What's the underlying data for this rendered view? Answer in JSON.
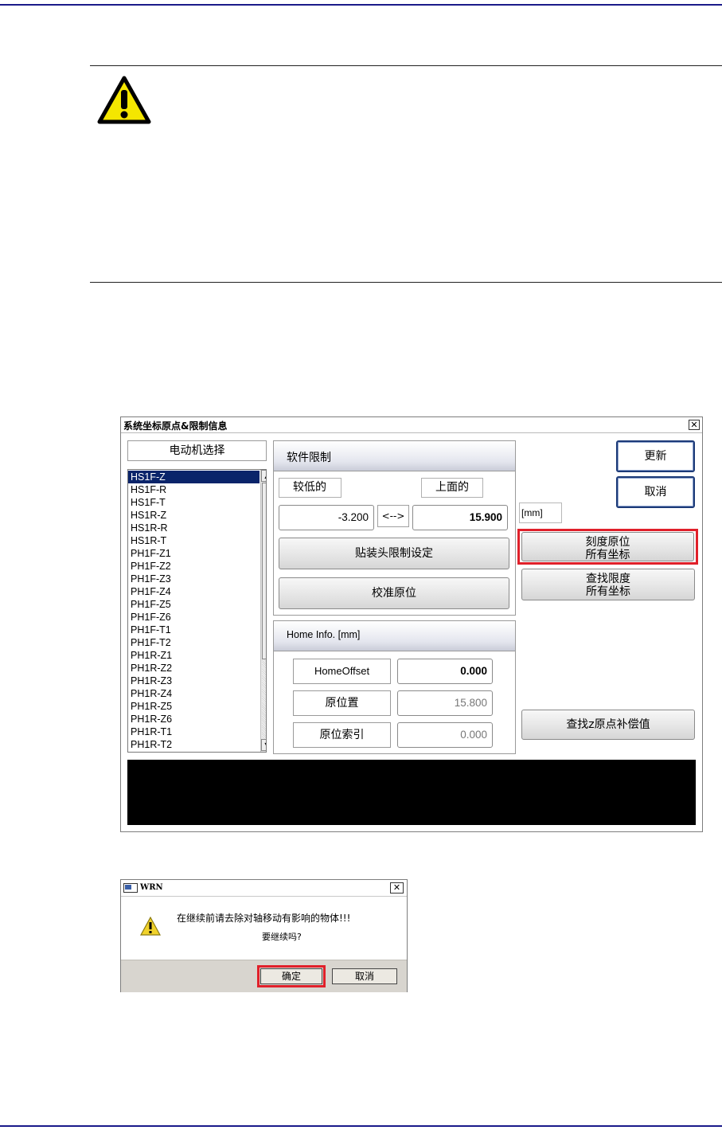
{
  "main_dialog": {
    "title": "系统坐标原点&限制信息",
    "close": "✕",
    "motor_select_label": "电动机选择",
    "motors": [
      "HS1F-Z",
      "HS1F-R",
      "HS1F-T",
      "HS1R-Z",
      "HS1R-R",
      "HS1R-T",
      "PH1F-Z1",
      "PH1F-Z2",
      "PH1F-Z3",
      "PH1F-Z4",
      "PH1F-Z5",
      "PH1F-Z6",
      "PH1F-T1",
      "PH1F-T2",
      "PH1R-Z1",
      "PH1R-Z2",
      "PH1R-Z3",
      "PH1R-Z4",
      "PH1R-Z5",
      "PH1R-Z6",
      "PH1R-T1",
      "PH1R-T2"
    ],
    "selected_motor": "HS1F-Z",
    "soft_limit": {
      "title": "软件限制",
      "lower_label": "较低的",
      "upper_label": "上面的",
      "range_symbol": "<-->",
      "lower_value": "-3.200",
      "upper_value": "15.900",
      "head_limit_button": "贴装头限制设定",
      "calibrate_home_button": "校准原位"
    },
    "home_info": {
      "title": "Home Info. [mm]",
      "rows": [
        {
          "label": "HomeOffset",
          "value": "0.000"
        },
        {
          "label": "原位置",
          "value": "15.800"
        },
        {
          "label": "原位索引",
          "value": "0.000"
        }
      ]
    },
    "unit_label": "[mm]",
    "buttons": {
      "update": "更新",
      "cancel": "取消",
      "scale_home_l1": "刻度原位",
      "scale_home_l2": "所有坐标",
      "find_limit_l1": "查找限度",
      "find_limit_l2": "所有坐标",
      "find_z_home": "查找z原点补偿值"
    }
  },
  "confirm_dialog": {
    "title": "WRN",
    "close": "✕",
    "message_line1": "在继续前请去除对轴移动有影响的物体!!!",
    "message_line2": "要继续吗?",
    "ok": "确定",
    "cancel": "取消"
  },
  "colors": {
    "highlight": "#e0202a",
    "rule": "#1a1a8a",
    "selection": "#0a246a"
  }
}
